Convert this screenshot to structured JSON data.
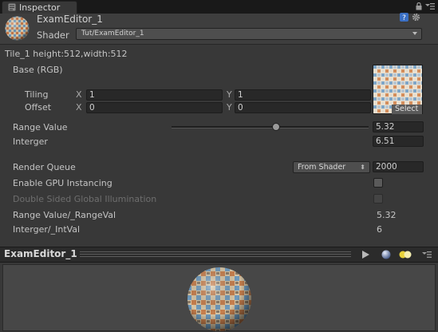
{
  "tab": {
    "label": "Inspector"
  },
  "header": {
    "material_name": "ExamEditor_1",
    "shader_label": "Shader",
    "shader_value": "Tut/ExamEditor_1"
  },
  "tile_info": "Tile_1  height:512,width:512",
  "base": {
    "label": "Base (RGB)",
    "tiling_label": "Tiling",
    "offset_label": "Offset",
    "x_label": "X",
    "y_label": "Y",
    "tiling_x": "1",
    "tiling_y": "1",
    "offset_x": "0",
    "offset_y": "0",
    "select_label": "Select"
  },
  "range_value": {
    "label": "Range Value",
    "value": "5.32",
    "slider_fraction": 0.53
  },
  "interger": {
    "label": "Interger",
    "value": "6.51"
  },
  "render_queue": {
    "label": "Render Queue",
    "dropdown": "From Shader",
    "value": "2000"
  },
  "gpu_instancing": {
    "label": "Enable GPU Instancing",
    "checked": false
  },
  "double_sided_gi": {
    "label": "Double Sided Global Illumination",
    "checked": false
  },
  "range_val_readout": {
    "label": "Range Value/_RangeVal",
    "value": "5.32"
  },
  "interger_readout": {
    "label": "Interger/_IntVal",
    "value": "6"
  },
  "preview": {
    "title": "ExamEditor_1"
  },
  "icons": {
    "tab": "inspector-icon",
    "lock": "lock-icon",
    "menu": "menu-icon",
    "help": "help-icon",
    "settings": "gear-icon",
    "play": "play-icon",
    "sphere": "sphere-icon",
    "light": "light-icon"
  },
  "colors": {
    "panel": "#383838",
    "field": "#282828",
    "tabbar": "#191919",
    "preview_bg": "#474747"
  }
}
